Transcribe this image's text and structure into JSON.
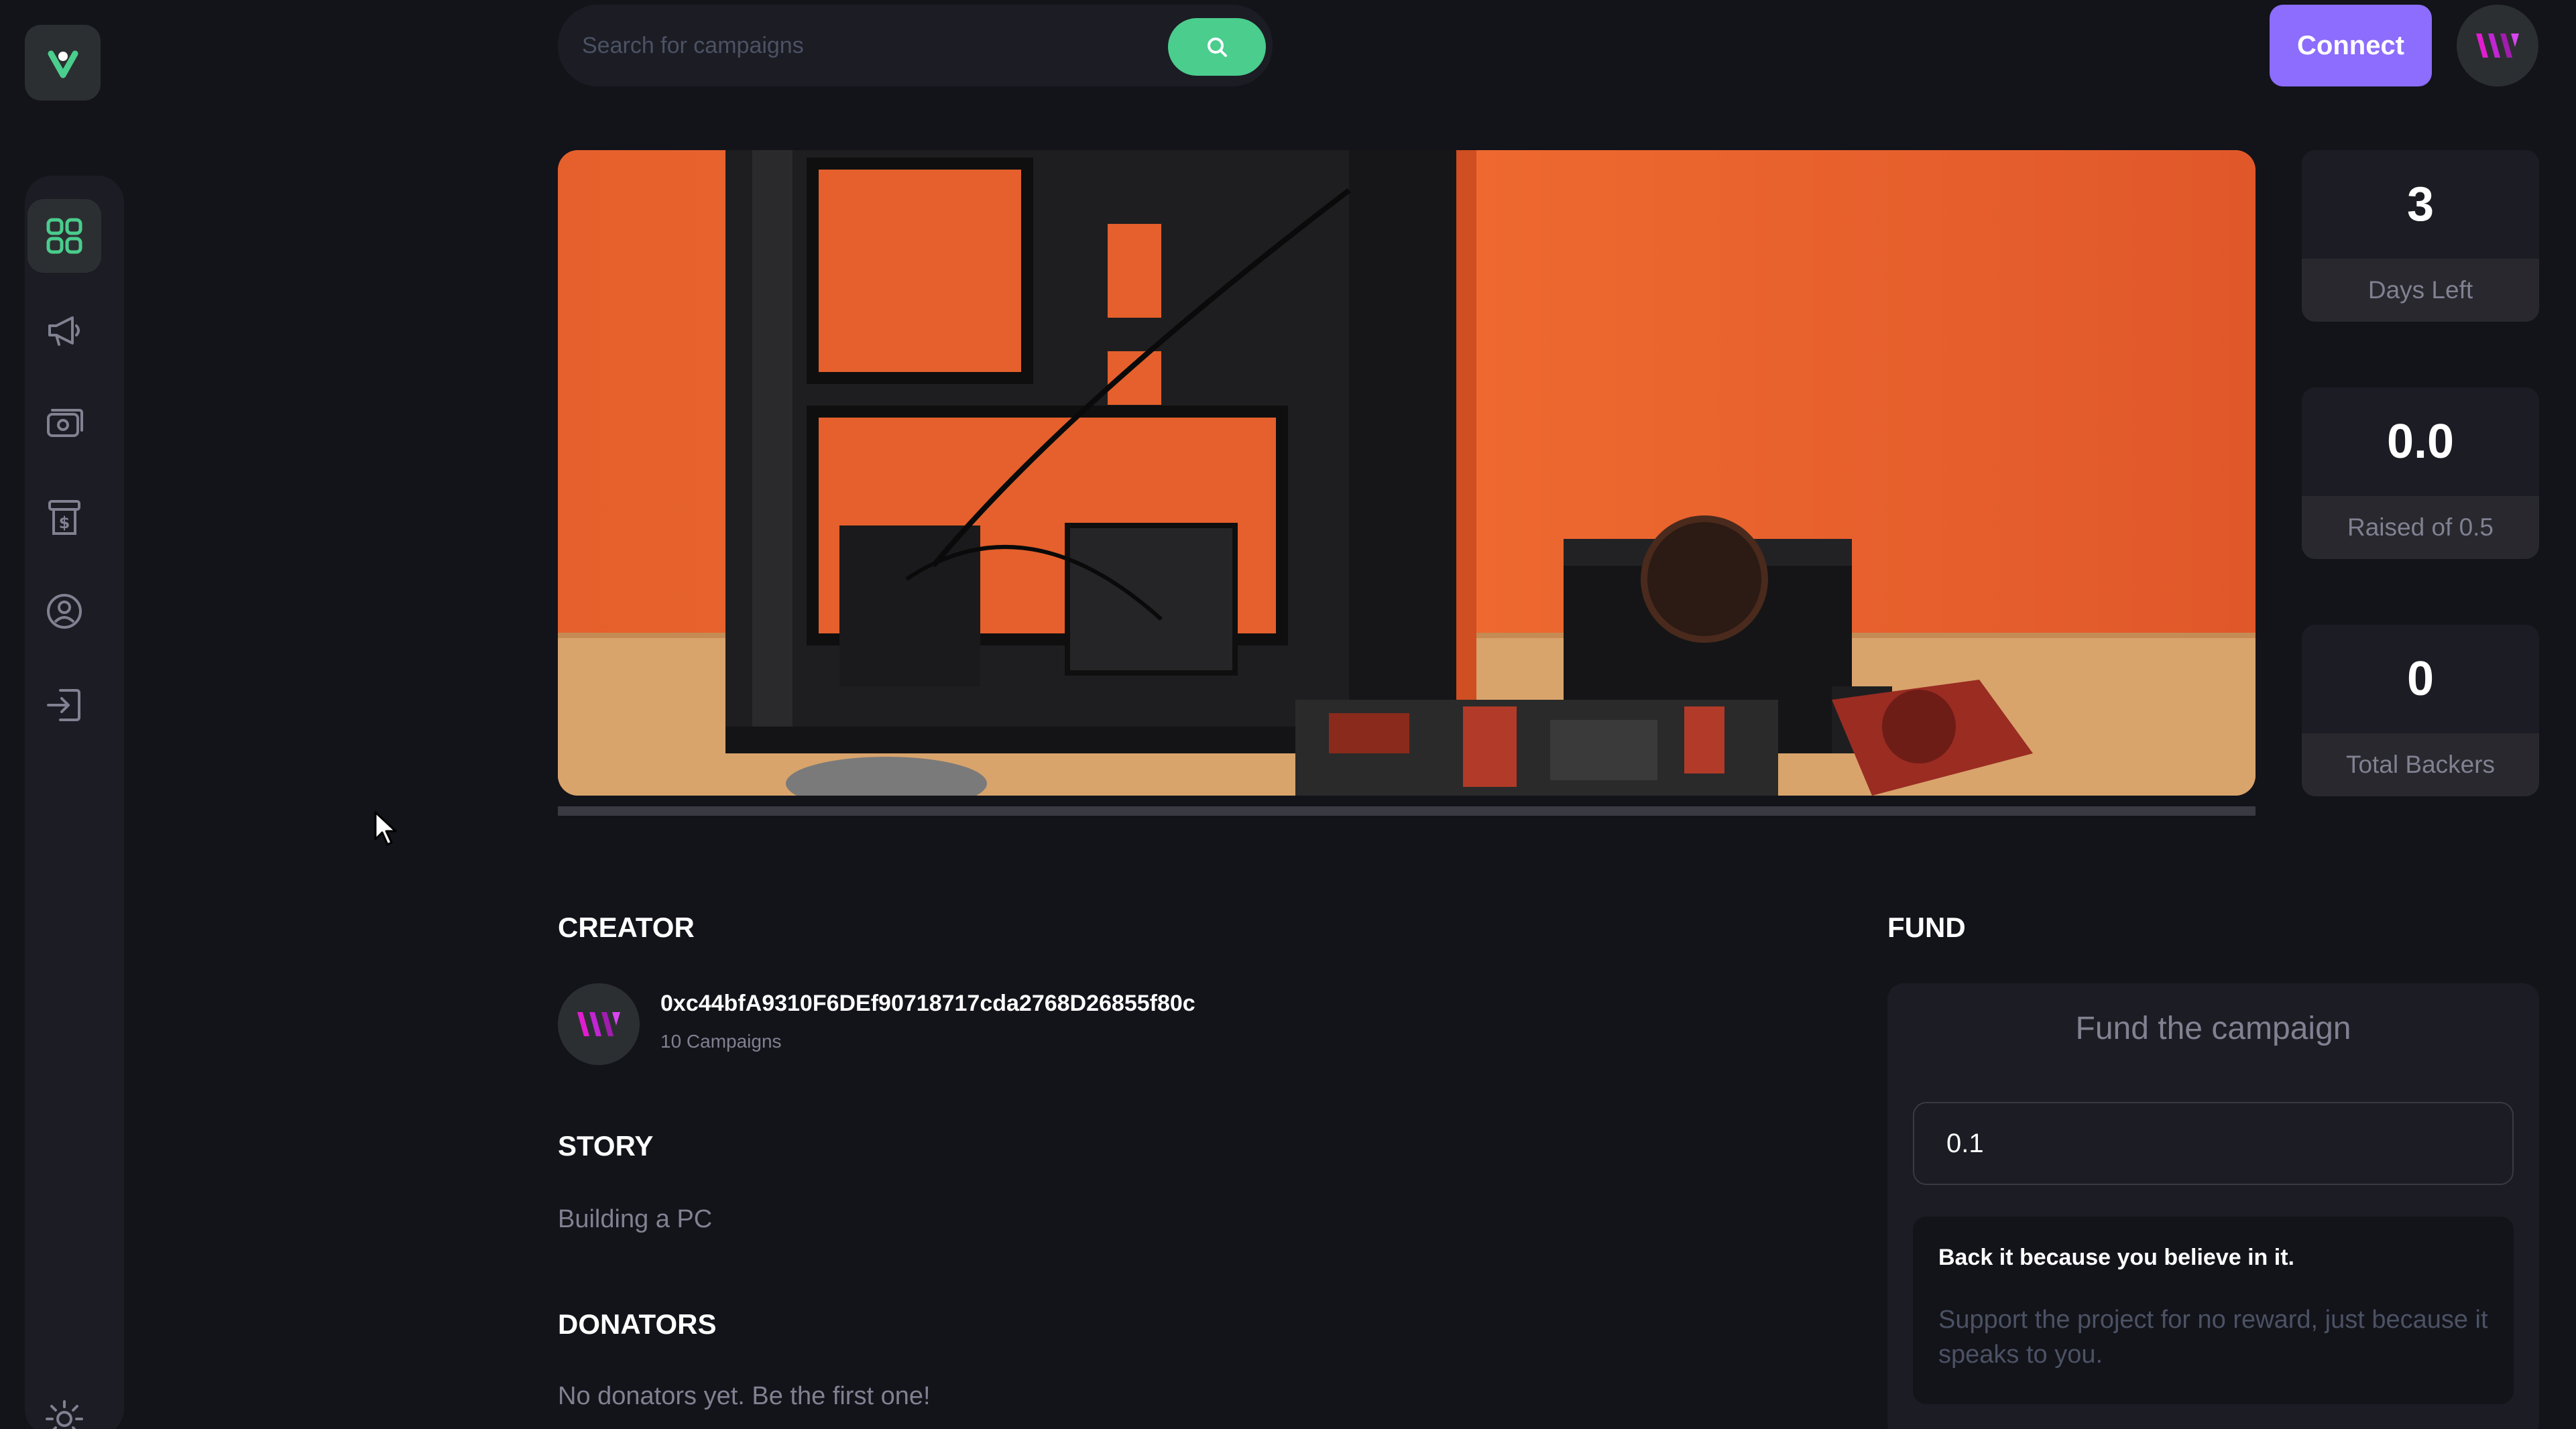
{
  "search": {
    "placeholder": "Search for campaigns"
  },
  "header": {
    "connect_label": "Connect"
  },
  "sidebar": {
    "items": [
      {
        "name": "dashboard",
        "icon": "dashboard-icon",
        "active": true
      },
      {
        "name": "campaign",
        "icon": "megaphone-icon",
        "active": false
      },
      {
        "name": "payment",
        "icon": "payment-icon",
        "active": false
      },
      {
        "name": "withdraw",
        "icon": "withdraw-icon",
        "active": false
      },
      {
        "name": "profile",
        "icon": "profile-icon",
        "active": false
      },
      {
        "name": "logout",
        "icon": "logout-icon",
        "active": false
      },
      {
        "name": "theme",
        "icon": "sun-icon",
        "active": false
      }
    ]
  },
  "campaign": {
    "progress_percent": 0
  },
  "stats": [
    {
      "value": "3",
      "label": "Days Left"
    },
    {
      "value": "0.0",
      "label": "Raised of 0.5"
    },
    {
      "value": "0",
      "label": "Total Backers"
    }
  ],
  "creator": {
    "title": "CREATOR",
    "address": "0xc44bfA9310F6DEf90718717cda2768D26855f80c",
    "campaigns": "10 Campaigns"
  },
  "story": {
    "title": "STORY",
    "text": "Building a PC"
  },
  "donators": {
    "title": "DONATORS",
    "empty_text": "No donators yet. Be the first one!"
  },
  "fund": {
    "title": "FUND",
    "heading": "Fund the campaign",
    "amount_value": "0.1",
    "believe_title": "Back it because you believe in it.",
    "believe_text": "Support the project for no reward, just because it speaks to you."
  },
  "colors": {
    "background": "#13131a",
    "panel": "#1c1c24",
    "accent_green": "#4acd8d",
    "accent_purple": "#8c6dfd",
    "muted_text": "#808191"
  }
}
